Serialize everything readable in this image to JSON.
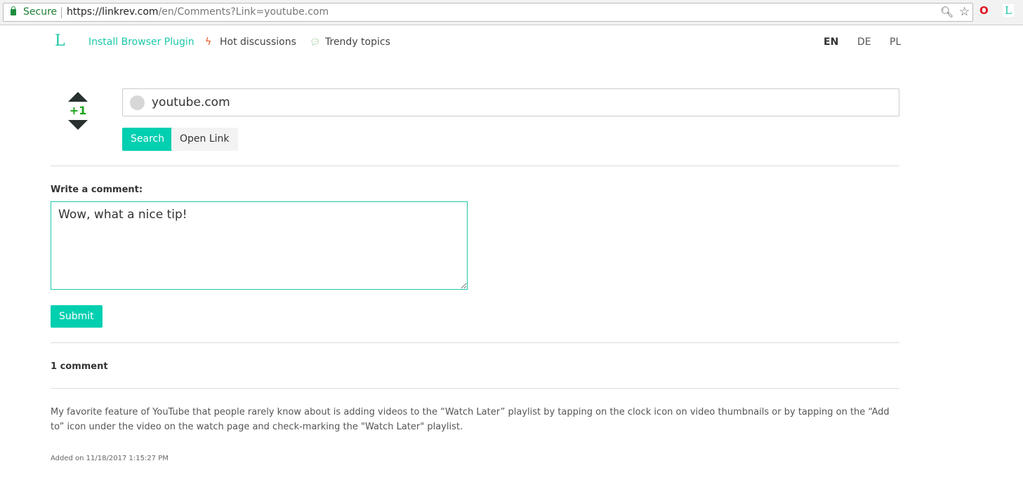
{
  "browser": {
    "secure_label": "Secure",
    "url_host": "https://linkrev.com",
    "url_path": "/en/Comments?Link=youtube.com"
  },
  "nav": {
    "logo": "L",
    "install": "Install Browser Plugin",
    "hot": "Hot discussions",
    "trendy": "Trendy topics",
    "langs": [
      "EN",
      "DE",
      "PL"
    ]
  },
  "vote": {
    "score": "+1"
  },
  "search": {
    "value": "youtube.com",
    "search_label": "Search",
    "open_label": "Open Link"
  },
  "comment_form": {
    "label": "Write a comment:",
    "value": "Wow, what a nice tip!",
    "submit_label": "Submit"
  },
  "comments": {
    "count_label": "1 comment",
    "items": [
      {
        "text": "My favorite feature of YouTube that people rarely know about is adding videos to the “Watch Later” playlist by tapping on the clock icon on video thumbnails or by tapping on the “Add to” icon under the video on the watch page and check-marking the \"Watch Later\" playlist.",
        "date": "Added on 11/18/2017 1:15:27 PM"
      }
    ]
  }
}
